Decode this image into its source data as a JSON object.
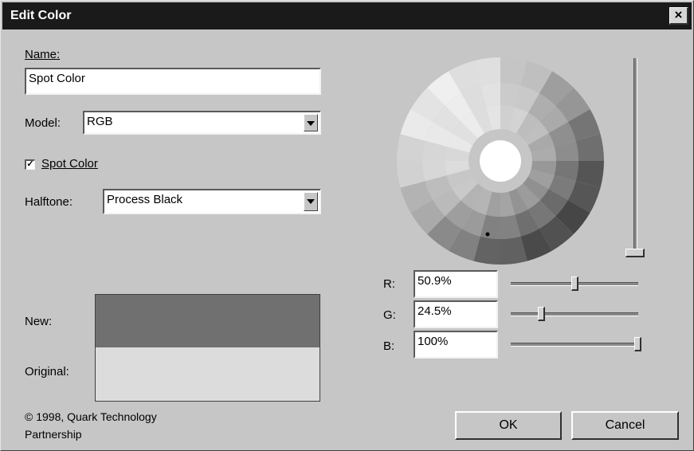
{
  "window": {
    "title": "Edit Color",
    "close_label": "×"
  },
  "name": {
    "label": "Name:",
    "value": "Spot Color"
  },
  "model": {
    "label": "Model:",
    "value": "RGB"
  },
  "spot_color": {
    "label": "Spot Color",
    "checked": true,
    "mark": "✓"
  },
  "halftone": {
    "label": "Halftone:",
    "value": "Process Black"
  },
  "preview": {
    "new_label": "New:",
    "original_label": "Original:",
    "new_color": "#707070",
    "original_color": "#dcdcdc"
  },
  "copyright": {
    "line1": "© 1998, Quark Technology",
    "line2": "Partnership"
  },
  "rgb": {
    "r": {
      "label": "R:",
      "value": "50.9%",
      "level": 0.509
    },
    "g": {
      "label": "G:",
      "value": "24.5%",
      "level": 0.245
    },
    "b": {
      "label": "B:",
      "value": "100%",
      "level": 1.0
    }
  },
  "brightness_level": 0.0,
  "buttons": {
    "ok": "OK",
    "cancel": "Cancel"
  },
  "icons": {
    "close": "close-icon",
    "dropdown": "chevron-down-icon",
    "check": "check-icon"
  }
}
